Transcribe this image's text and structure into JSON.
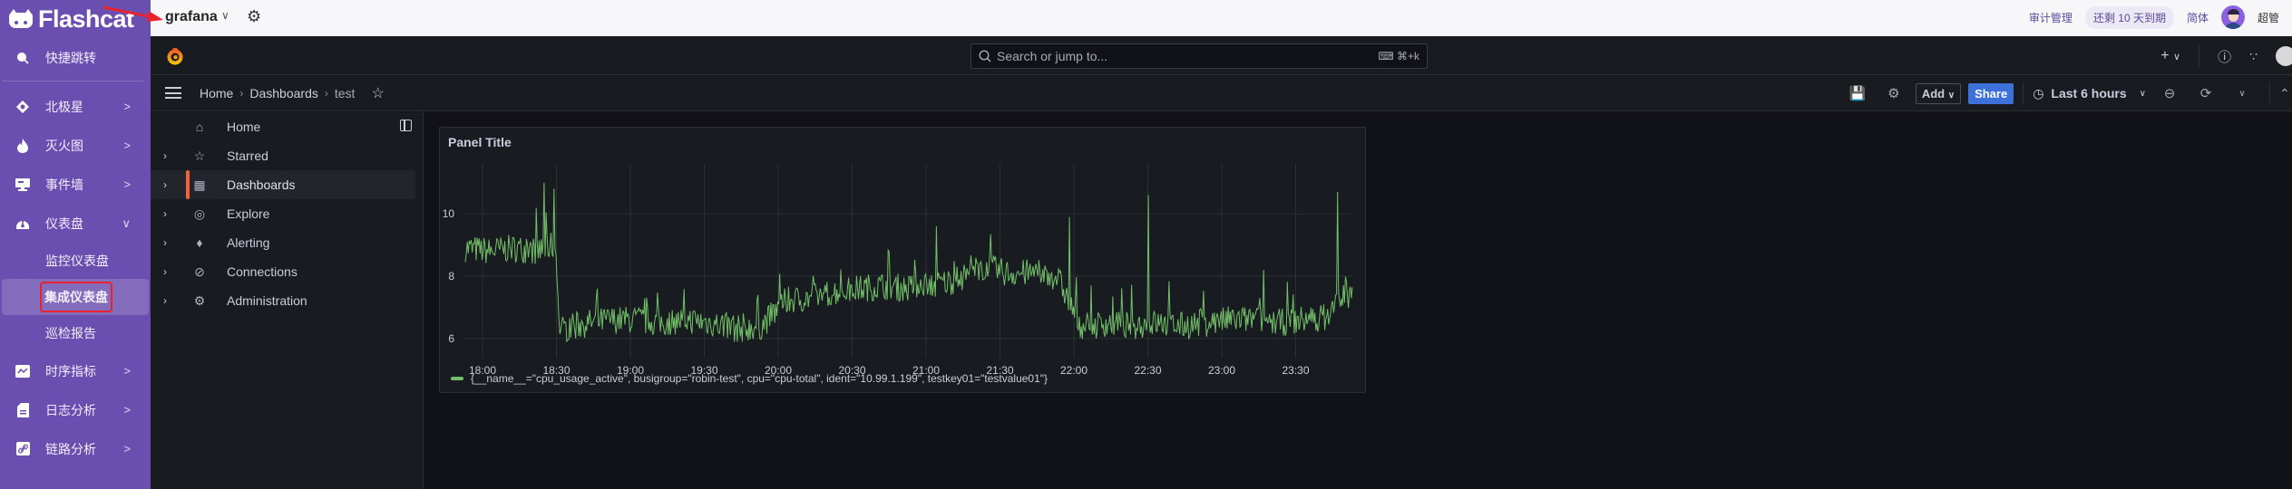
{
  "flashcat": {
    "brand": "Flashcat",
    "menu": [
      {
        "label": "快捷跳转",
        "icon": "search-icon",
        "expandable": false
      },
      {
        "label": "北极星",
        "icon": "polaris-icon",
        "expandable": true
      },
      {
        "label": "灭火图",
        "icon": "fire-icon",
        "expandable": true
      },
      {
        "label": "事件墙",
        "icon": "monitor-icon",
        "expandable": true
      },
      {
        "label": "仪表盘",
        "icon": "gauge-icon",
        "expandable": true,
        "expanded": true
      },
      {
        "label": "时序指标",
        "icon": "chart-icon",
        "expandable": true
      },
      {
        "label": "日志分析",
        "icon": "document-icon",
        "expandable": true
      },
      {
        "label": "链路分析",
        "icon": "link-icon",
        "expandable": true
      }
    ],
    "submenu": [
      {
        "label": "监控仪表盘",
        "active": false
      },
      {
        "label": "集成仪表盘",
        "active": true
      },
      {
        "label": "巡检报告",
        "active": false
      }
    ]
  },
  "topbar": {
    "datasource": "grafana",
    "audit": "审计管理",
    "expiry_badge": "还剩 10 天到期",
    "language": "简体",
    "user": "超管"
  },
  "grafana": {
    "search_placeholder": "Search or jump to...",
    "search_shortcut": "⌘+k",
    "breadcrumb": [
      "Home",
      "Dashboards",
      "test"
    ],
    "toolbar": {
      "add_label": "Add",
      "share_label": "Share",
      "time_range": "Last 6 hours"
    },
    "nav": [
      {
        "label": "Home",
        "icon": "home-icon",
        "expandable": false,
        "active": false
      },
      {
        "label": "Starred",
        "icon": "star-icon",
        "expandable": true,
        "active": false
      },
      {
        "label": "Dashboards",
        "icon": "apps-icon",
        "expandable": true,
        "active": true
      },
      {
        "label": "Explore",
        "icon": "compass-icon",
        "expandable": true,
        "active": false
      },
      {
        "label": "Alerting",
        "icon": "bell-icon",
        "expandable": true,
        "active": false
      },
      {
        "label": "Connections",
        "icon": "connections-icon",
        "expandable": true,
        "active": false
      },
      {
        "label": "Administration",
        "icon": "gear-icon",
        "expandable": true,
        "active": false
      }
    ],
    "panel": {
      "title": "Panel Title"
    }
  },
  "chart_data": {
    "type": "line",
    "title": "Panel Title",
    "xlabel": "",
    "ylabel": "",
    "x_ticks": [
      "18:00",
      "18:30",
      "19:00",
      "19:30",
      "20:00",
      "20:30",
      "21:00",
      "21:30",
      "22:00",
      "22:30",
      "23:00",
      "23:30"
    ],
    "y_ticks": [
      6,
      8,
      10
    ],
    "x_range": [
      "17:53",
      "23:53"
    ],
    "ylim": [
      5.5,
      11.6
    ],
    "grid": true,
    "legend_position": "bottom-left",
    "series": [
      {
        "name": "{__name__=\"cpu_usage_active\", busigroup=\"robin-test\", cpu=\"cpu-total\", ident=\"10.99.1.199\", testkey01=\"testvalue01\"}",
        "color": "#73bf69",
        "x_minutes_from_start": [
          0,
          10,
          20,
          30,
          35,
          37,
          38,
          40,
          50,
          60,
          70,
          80,
          90,
          100,
          110,
          120,
          125,
          130,
          140,
          150,
          160,
          170,
          180,
          185,
          190,
          200,
          210,
          220,
          230,
          240,
          250,
          255,
          260,
          270,
          280,
          290,
          300,
          310,
          320,
          330,
          340,
          350,
          355,
          358,
          360
        ],
        "values": [
          8.9,
          8.8,
          8.9,
          8.8,
          9.0,
          8.8,
          6.4,
          6.3,
          6.5,
          6.6,
          6.6,
          6.5,
          6.6,
          6.5,
          6.3,
          6.4,
          6.8,
          7.2,
          7.3,
          7.5,
          7.6,
          7.7,
          7.6,
          7.8,
          7.7,
          7.9,
          8.3,
          8.1,
          8.1,
          8.0,
          6.4,
          6.4,
          6.5,
          6.4,
          6.5,
          6.4,
          6.5,
          6.6,
          6.6,
          6.5,
          6.6,
          6.7,
          7.3,
          7.4,
          7.5
        ],
        "spikes": [
          {
            "x_minute": 32,
            "value": 11.0
          },
          {
            "x_minute": 36,
            "value": 10.8
          },
          {
            "x_minute": 191,
            "value": 9.6
          },
          {
            "x_minute": 245,
            "value": 9.9
          },
          {
            "x_minute": 277,
            "value": 10.6
          },
          {
            "x_minute": 324,
            "value": 8.2
          },
          {
            "x_minute": 354,
            "value": 10.7
          }
        ]
      }
    ]
  }
}
